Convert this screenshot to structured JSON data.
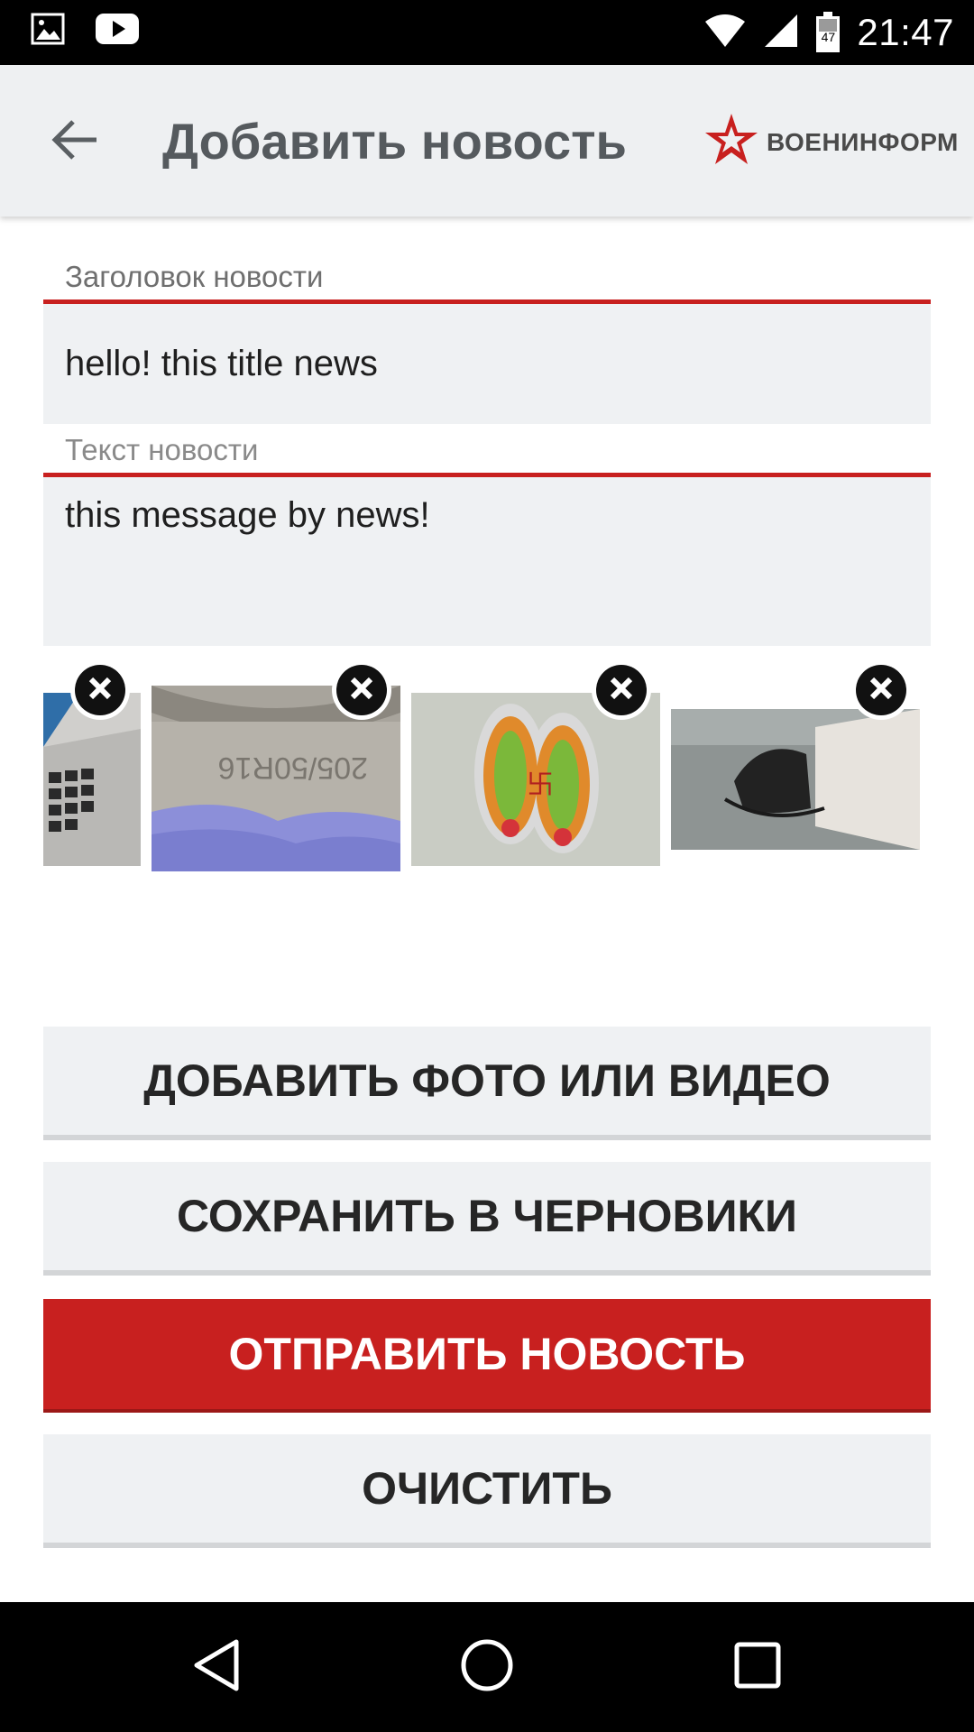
{
  "status_bar": {
    "time": "21:47",
    "battery_level": "47",
    "icons": [
      "image-icon",
      "youtube-icon",
      "wifi-icon",
      "signal-icon",
      "battery-icon"
    ]
  },
  "app_bar": {
    "title": "Добавить новость",
    "brand": "ВОЕНИНФОРМ"
  },
  "form": {
    "title_field": {
      "label": "Заголовок новости",
      "value": "hello! this title news"
    },
    "body_field": {
      "label": "Текст новости",
      "value": "this message by news!"
    }
  },
  "attachments": [
    {
      "subject": "laptop keyboard"
    },
    {
      "subject": "tire sidewall"
    },
    {
      "subject": "decorative footprints"
    },
    {
      "subject": "bag on floor"
    }
  ],
  "buttons": {
    "add_media": "ДОБАВИТЬ ФОТО ИЛИ ВИДЕО",
    "save_draft": "СОХРАНИТЬ В ЧЕРНОВИКИ",
    "send": "ОТПРАВИТЬ НОВОСТЬ",
    "clear": "ОЧИСТИТЬ"
  },
  "colors": {
    "accent": "#c8201f",
    "field_bg": "#eff1f3",
    "app_bar_bg": "#eef0f2"
  }
}
